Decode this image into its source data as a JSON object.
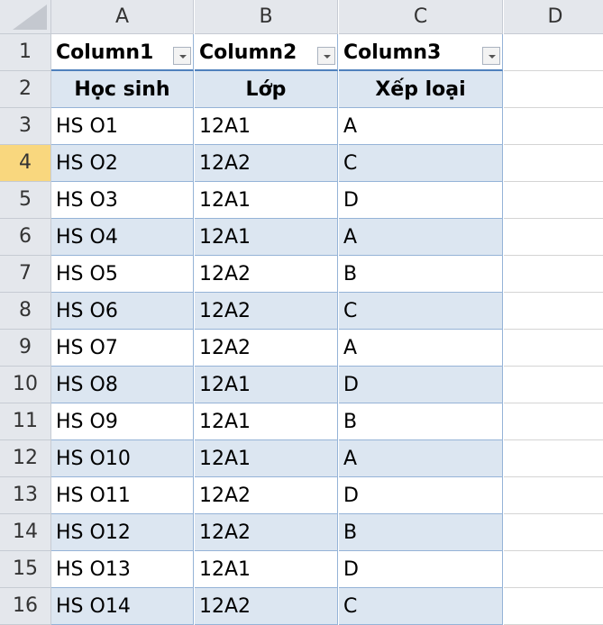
{
  "columns": [
    "A",
    "B",
    "C",
    "D"
  ],
  "selected_row": 4,
  "table": {
    "headers": [
      "Column1",
      "Column2",
      "Column3"
    ],
    "subheaders": [
      "Học sinh",
      "Lớp",
      "Xếp loại"
    ],
    "rows": [
      [
        "HS O1",
        "12A1",
        "A"
      ],
      [
        "HS O2",
        "12A2",
        "C"
      ],
      [
        "HS O3",
        "12A1",
        "D"
      ],
      [
        "HS O4",
        "12A1",
        "A"
      ],
      [
        "HS O5",
        "12A2",
        "B"
      ],
      [
        "HS O6",
        "12A2",
        "C"
      ],
      [
        "HS O7",
        "12A2",
        "A"
      ],
      [
        "HS O8",
        "12A1",
        "D"
      ],
      [
        "HS O9",
        "12A1",
        "B"
      ],
      [
        "HS O10",
        "12A1",
        "A"
      ],
      [
        "HS O11",
        "12A2",
        "D"
      ],
      [
        "HS O12",
        "12A2",
        "B"
      ],
      [
        "HS O13",
        "12A1",
        "D"
      ],
      [
        "HS O14",
        "12A2",
        "C"
      ]
    ]
  },
  "row_numbers": [
    "1",
    "2",
    "3",
    "4",
    "5",
    "6",
    "7",
    "8",
    "9",
    "10",
    "11",
    "12",
    "13",
    "14",
    "15",
    "16"
  ]
}
